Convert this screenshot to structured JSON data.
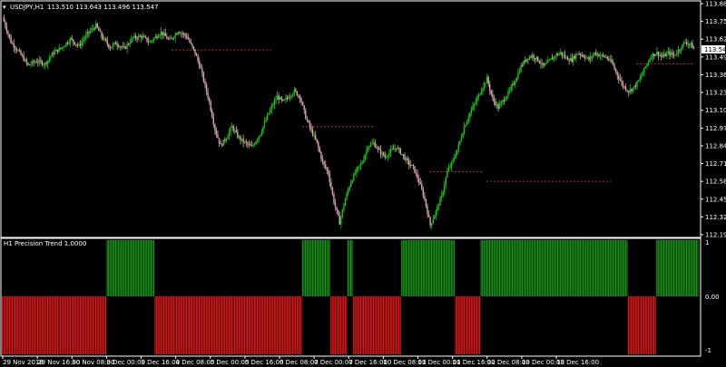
{
  "window": {
    "symbol_label": "USDJPY,H1",
    "ohlc_label": "113.510 113.643 113.496 113.547",
    "current_price_label": "113.547"
  },
  "indicator": {
    "title": "H1 Precision Trend 1.0000",
    "axis_labels": [
      "1",
      "0.00",
      "-1"
    ]
  },
  "colors": {
    "background": "#000000",
    "bull_candle": "#1fc41f",
    "bear_candle": "#d8a7a7",
    "up_hist": "#1a9a1a",
    "down_hist": "#e21b1b",
    "level_line": "#c0392b",
    "axis": "#ffffff"
  },
  "chart_data": {
    "type": "candlestick",
    "price_axis": {
      "ticks": [
        "113.880",
        "113.750",
        "113.620",
        "113.490",
        "113.360",
        "113.230",
        "113.100",
        "112.970",
        "112.840",
        "112.710",
        "112.580",
        "112.450",
        "112.320",
        "112.190"
      ],
      "range": [
        112.19,
        113.88
      ]
    },
    "time_axis": {
      "ticks": [
        "29 Nov 2018",
        "29 Nov 16:00",
        "30 Nov 08:00",
        "3 Dec 00:00",
        "3 Dec 16:00",
        "4 Dec 08:00",
        "5 Dec 00:00",
        "5 Dec 16:00",
        "6 Dec 08:00",
        "7 Dec 00:00",
        "7 Dec 16:00",
        "10 Dec 08:00",
        "11 Dec 00:00",
        "11 Dec 16:00",
        "12 Dec 08:00",
        "13 Dec 00:00",
        "13 Dec 16:00"
      ]
    },
    "close_path": [
      [
        0,
        113.78
      ],
      [
        6,
        113.6
      ],
      [
        12,
        113.52
      ],
      [
        18,
        113.43
      ],
      [
        24,
        113.46
      ],
      [
        30,
        113.44
      ],
      [
        36,
        113.52
      ],
      [
        42,
        113.56
      ],
      [
        48,
        113.62
      ],
      [
        54,
        113.57
      ],
      [
        60,
        113.66
      ],
      [
        66,
        113.72
      ],
      [
        70,
        113.64
      ],
      [
        76,
        113.56
      ],
      [
        80,
        113.59
      ],
      [
        86,
        113.55
      ],
      [
        92,
        113.63
      ],
      [
        98,
        113.64
      ],
      [
        104,
        113.6
      ],
      [
        112,
        113.67
      ],
      [
        118,
        113.61
      ],
      [
        124,
        113.68
      ],
      [
        130,
        113.64
      ],
      [
        136,
        113.52
      ],
      [
        140,
        113.4
      ],
      [
        146,
        113.16
      ],
      [
        150,
        112.96
      ],
      [
        154,
        112.84
      ],
      [
        158,
        112.9
      ],
      [
        162,
        112.98
      ],
      [
        166,
        112.91
      ],
      [
        170,
        112.87
      ],
      [
        176,
        112.83
      ],
      [
        182,
        112.93
      ],
      [
        188,
        113.08
      ],
      [
        194,
        113.2
      ],
      [
        198,
        113.16
      ],
      [
        202,
        113.2
      ],
      [
        206,
        113.24
      ],
      [
        210,
        113.2
      ],
      [
        214,
        113.05
      ],
      [
        218,
        112.95
      ],
      [
        222,
        112.86
      ],
      [
        226,
        112.72
      ],
      [
        230,
        112.64
      ],
      [
        234,
        112.43
      ],
      [
        238,
        112.28
      ],
      [
        242,
        112.45
      ],
      [
        246,
        112.58
      ],
      [
        250,
        112.66
      ],
      [
        254,
        112.72
      ],
      [
        258,
        112.84
      ],
      [
        262,
        112.86
      ],
      [
        266,
        112.8
      ],
      [
        270,
        112.76
      ],
      [
        274,
        112.8
      ],
      [
        278,
        112.83
      ],
      [
        282,
        112.78
      ],
      [
        286,
        112.72
      ],
      [
        290,
        112.68
      ],
      [
        294,
        112.58
      ],
      [
        298,
        112.45
      ],
      [
        302,
        112.26
      ],
      [
        306,
        112.36
      ],
      [
        310,
        112.47
      ],
      [
        314,
        112.65
      ],
      [
        318,
        112.73
      ],
      [
        322,
        112.84
      ],
      [
        326,
        112.98
      ],
      [
        330,
        113.08
      ],
      [
        334,
        113.16
      ],
      [
        338,
        113.25
      ],
      [
        342,
        113.33
      ],
      [
        346,
        113.18
      ],
      [
        350,
        113.12
      ],
      [
        354,
        113.18
      ],
      [
        358,
        113.24
      ],
      [
        362,
        113.32
      ],
      [
        366,
        113.42
      ],
      [
        370,
        113.48
      ],
      [
        374,
        113.5
      ],
      [
        378,
        113.47
      ],
      [
        382,
        113.42
      ],
      [
        386,
        113.46
      ],
      [
        390,
        113.5
      ],
      [
        394,
        113.52
      ],
      [
        398,
        113.48
      ],
      [
        402,
        113.47
      ],
      [
        406,
        113.52
      ],
      [
        410,
        113.5
      ],
      [
        414,
        113.47
      ],
      [
        418,
        113.52
      ],
      [
        422,
        113.5
      ],
      [
        426,
        113.49
      ],
      [
        430,
        113.45
      ],
      [
        434,
        113.36
      ],
      [
        438,
        113.28
      ],
      [
        442,
        113.24
      ],
      [
        446,
        113.27
      ],
      [
        450,
        113.33
      ],
      [
        454,
        113.42
      ],
      [
        458,
        113.5
      ],
      [
        462,
        113.52
      ],
      [
        466,
        113.49
      ],
      [
        470,
        113.52
      ],
      [
        474,
        113.5
      ],
      [
        478,
        113.55
      ],
      [
        482,
        113.6
      ],
      [
        486,
        113.58
      ],
      [
        488,
        113.547
      ]
    ],
    "level_lines": [
      {
        "price": 113.54,
        "from_bar": 120,
        "to_bar": 190
      },
      {
        "price": 112.98,
        "from_bar": 212,
        "to_bar": 262
      },
      {
        "price": 112.65,
        "from_bar": 302,
        "to_bar": 340
      },
      {
        "price": 112.58,
        "from_bar": 342,
        "to_bar": 430
      },
      {
        "price": 113.44,
        "from_bar": 448,
        "to_bar": 488
      }
    ],
    "histogram": {
      "scale": [
        -1,
        1
      ],
      "segments": [
        {
          "from_bar": 0,
          "to_bar": 74,
          "value": -1
        },
        {
          "from_bar": 74,
          "to_bar": 108,
          "value": 1
        },
        {
          "from_bar": 108,
          "to_bar": 212,
          "value": -1
        },
        {
          "from_bar": 212,
          "to_bar": 232,
          "value": 1
        },
        {
          "from_bar": 232,
          "to_bar": 244,
          "value": -1
        },
        {
          "from_bar": 244,
          "to_bar": 248,
          "value": 1
        },
        {
          "from_bar": 248,
          "to_bar": 282,
          "value": -1
        },
        {
          "from_bar": 282,
          "to_bar": 320,
          "value": 1
        },
        {
          "from_bar": 320,
          "to_bar": 338,
          "value": -1
        },
        {
          "from_bar": 338,
          "to_bar": 442,
          "value": 1
        },
        {
          "from_bar": 442,
          "to_bar": 462,
          "value": -1
        },
        {
          "from_bar": 462,
          "to_bar": 492,
          "value": 1
        }
      ]
    }
  }
}
